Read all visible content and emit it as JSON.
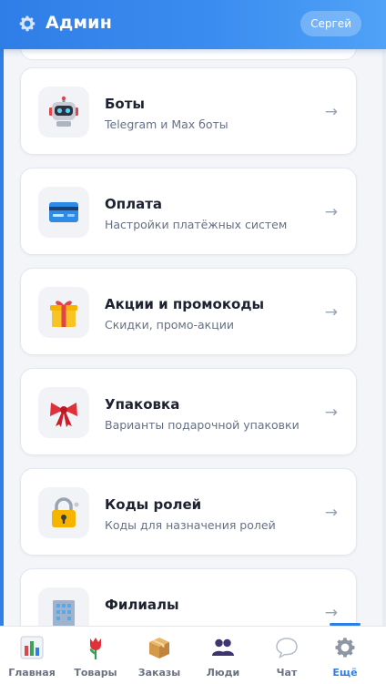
{
  "header": {
    "title": "Админ",
    "user_button": "Сергей",
    "icon": "gear-icon"
  },
  "cards": [
    {
      "title": "Боты",
      "subtitle": "Telegram и Max боты",
      "icon": "robot-icon",
      "arrow": "→"
    },
    {
      "title": "Оплата",
      "subtitle": "Настройки платёжных систем",
      "icon": "credit-card-icon",
      "arrow": "→"
    },
    {
      "title": "Акции и промокоды",
      "subtitle": "Скидки, промо-акции",
      "icon": "gift-icon",
      "arrow": "→"
    },
    {
      "title": "Упаковка",
      "subtitle": "Варианты подарочной упаковки",
      "icon": "ribbon-icon",
      "arrow": "→"
    },
    {
      "title": "Коды ролей",
      "subtitle": "Коды для назначения ролей",
      "icon": "lock-icon",
      "arrow": "→"
    },
    {
      "title": "Филиалы",
      "subtitle": "",
      "icon": "building-icon",
      "arrow": "→"
    }
  ],
  "nav": [
    {
      "label": "Главная",
      "icon": "chart-icon"
    },
    {
      "label": "Товары",
      "icon": "tulip-icon"
    },
    {
      "label": "Заказы",
      "icon": "box-icon"
    },
    {
      "label": "Люди",
      "icon": "people-icon"
    },
    {
      "label": "Чат",
      "icon": "speech-bubble-icon"
    },
    {
      "label": "Ещё",
      "icon": "gear-icon",
      "active": true
    }
  ],
  "colors": {
    "accent": "#2f7ee7",
    "background": "#f3f5f8",
    "card": "#ffffff"
  }
}
